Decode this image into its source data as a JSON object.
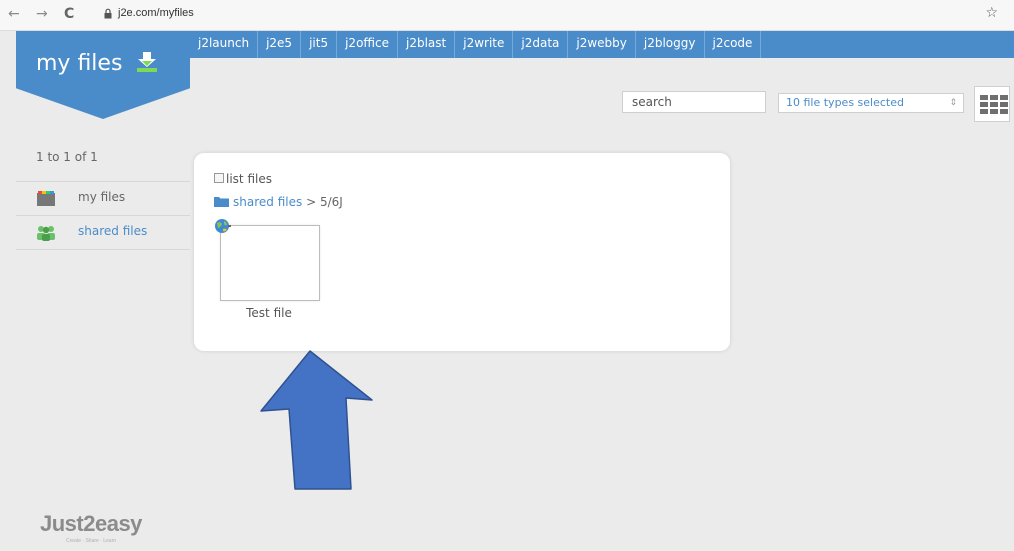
{
  "browser": {
    "url": "j2e.com/myfiles",
    "back_icon": "←",
    "forward_icon": "→",
    "reload_icon": "C",
    "star_icon": "☆"
  },
  "header": {
    "title": "my files",
    "nav": [
      "j2launch",
      "j2e5",
      "jit5",
      "j2office",
      "j2blast",
      "j2write",
      "j2data",
      "j2webby",
      "j2bloggy",
      "j2code"
    ]
  },
  "toolbar": {
    "search_placeholder": "search",
    "filter_value": "10 file types selected"
  },
  "sidebar": {
    "count": "1 to 1 of 1",
    "items": [
      {
        "label": "my files"
      },
      {
        "label": "shared files"
      }
    ]
  },
  "main": {
    "list_files_label": "list files",
    "breadcrumb": {
      "folder": "shared files",
      "separator": ">",
      "current": "5/6J"
    },
    "files": [
      {
        "name": "Test file"
      }
    ]
  },
  "footer": {
    "brand": "Just2easy",
    "tagline": "Create · Share · Learn"
  },
  "colors": {
    "brand_blue": "#4a8cc9",
    "arrow_blue": "#4472c4"
  }
}
